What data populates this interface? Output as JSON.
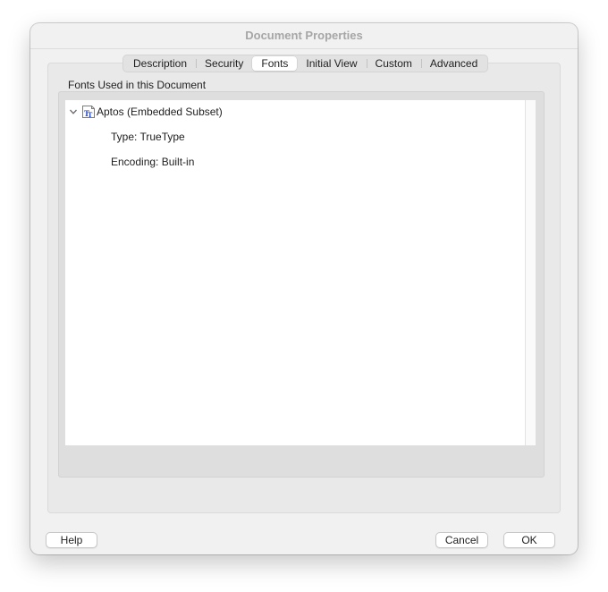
{
  "window": {
    "title": "Document Properties"
  },
  "tabs": [
    {
      "label": "Description",
      "active": false
    },
    {
      "label": "Security",
      "active": false
    },
    {
      "label": "Fonts",
      "active": true
    },
    {
      "label": "Initial View",
      "active": false
    },
    {
      "label": "Custom",
      "active": false
    },
    {
      "label": "Advanced",
      "active": false
    }
  ],
  "fonts_section": {
    "label": "Fonts Used in this Document",
    "font": {
      "name": "Aptos (Embedded Subset)",
      "expanded": true,
      "icon": "truetype-font-icon",
      "details": {
        "type": "Type: TrueType",
        "encoding": "Encoding: Built-in"
      }
    }
  },
  "buttons": {
    "help": "Help",
    "cancel": "Cancel",
    "ok": "OK"
  },
  "colors": {
    "window_bg": "#f1f1f1",
    "title_text": "#a6a6a6",
    "font_icon_blue": "#1f3fbf"
  }
}
